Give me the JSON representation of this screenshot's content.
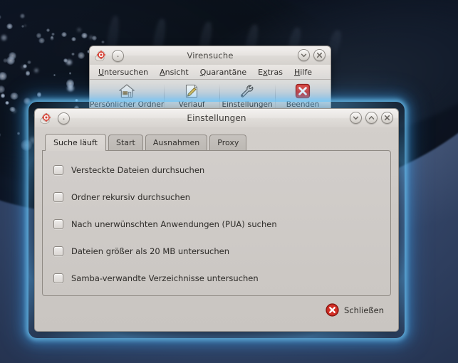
{
  "desktop": {
    "wallpaper_description": "whale-shark-photo",
    "background_color": "#32476b",
    "shark_color": "#0b111c"
  },
  "main_window": {
    "title": "Virensuche",
    "titlebar_icons": [
      {
        "name": "app-icon",
        "label": "app-icon"
      },
      {
        "name": "window-menu-button",
        "label": "window-menu"
      }
    ],
    "controls": [
      {
        "name": "minimize-button",
        "glyph": "chevron-down-icon"
      },
      {
        "name": "close-button",
        "glyph": "close-x-icon"
      }
    ],
    "menu": [
      {
        "label": "Untersuchen",
        "accel": "U"
      },
      {
        "label": "Ansicht",
        "accel": "A"
      },
      {
        "label": "Quarantäne",
        "accel": "Q"
      },
      {
        "label": "Extras",
        "accel": "x"
      },
      {
        "label": "Hilfe",
        "accel": "H"
      }
    ],
    "toolbar": [
      {
        "label": "Persönlicher Ordner",
        "icon": "home-folder-icon"
      },
      {
        "label": "Verlauf",
        "icon": "notepad-pencil-icon"
      },
      {
        "label": "Einstellungen",
        "icon": "wrench-icon"
      },
      {
        "label": "Beenden",
        "icon": "red-x-icon"
      }
    ]
  },
  "settings_dialog": {
    "title": "Einstellungen",
    "focused": true,
    "glow_color": "#5abaff",
    "controls": [
      {
        "name": "minimize-button",
        "glyph": "chevron-down-icon"
      },
      {
        "name": "maximize-button",
        "glyph": "chevron-up-icon"
      },
      {
        "name": "close-button",
        "glyph": "close-x-icon"
      }
    ],
    "tabs": [
      {
        "label": "Suche läuft",
        "active": true
      },
      {
        "label": "Start",
        "active": false
      },
      {
        "label": "Ausnahmen",
        "active": false
      },
      {
        "label": "Proxy",
        "active": false
      }
    ],
    "options": [
      {
        "label": "Versteckte Dateien durchsuchen",
        "checked": false
      },
      {
        "label": "Ordner rekursiv durchsuchen",
        "checked": false
      },
      {
        "label": "Nach unerwünschten Anwendungen (PUA) suchen",
        "checked": false
      },
      {
        "label": "Dateien größer als 20 MB untersuchen",
        "checked": false
      },
      {
        "label": "Samba-verwandte Verzeichnisse untersuchen",
        "checked": false
      }
    ],
    "close_button": {
      "label": "Schließen",
      "icon": "red-circle-x-icon"
    }
  }
}
